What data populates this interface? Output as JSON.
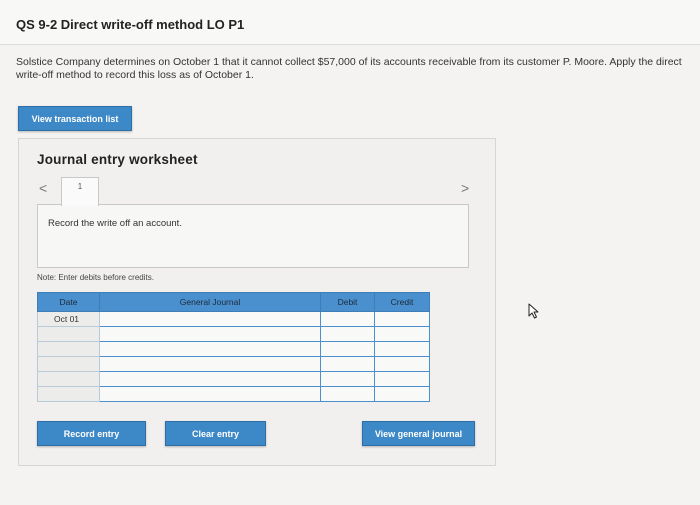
{
  "header": {
    "title": "QS 9-2 Direct write-off method LO P1"
  },
  "problem": {
    "text": "Solstice Company determines on October 1 that it cannot collect $57,000 of its accounts receivable from its customer P. Moore. Apply the direct write-off method to record this loss as of October 1."
  },
  "toolbar": {
    "view_transactions_label": "View transaction list"
  },
  "worksheet": {
    "title": "Journal entry worksheet",
    "nav_prev": "<",
    "nav_next": ">",
    "current_tab": "1",
    "instruction": "Record the write off an account.",
    "note": "Note: Enter debits before credits.",
    "table": {
      "headers": {
        "date": "Date",
        "general_journal": "General Journal",
        "debit": "Debit",
        "credit": "Credit"
      },
      "rows": [
        {
          "date": "Oct 01"
        },
        {
          "date": ""
        },
        {
          "date": ""
        },
        {
          "date": ""
        },
        {
          "date": ""
        },
        {
          "date": ""
        }
      ]
    },
    "buttons": {
      "record_entry": "Record entry",
      "clear_entry": "Clear entry",
      "view_general_journal": "View general journal"
    }
  },
  "icons": {
    "cursor": "mouse-pointer-icon"
  },
  "colors": {
    "button_blue": "#3d88c6",
    "table_header_blue": "#4a8fce",
    "background": "#f4f3f1"
  }
}
